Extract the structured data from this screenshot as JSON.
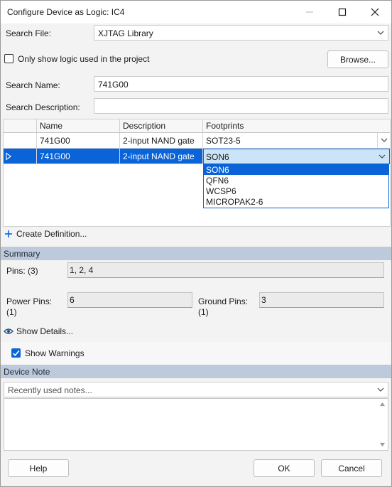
{
  "window": {
    "title": "Configure Device as Logic: IC4"
  },
  "search_file": {
    "label": "Search File:",
    "value": "XJTAG Library"
  },
  "only_show": {
    "label": "Only show logic used in the project",
    "checked": false
  },
  "browse_label": "Browse...",
  "search_name": {
    "label": "Search Name:",
    "value": "741G00"
  },
  "search_description": {
    "label": "Search Description:",
    "value": ""
  },
  "grid": {
    "columns": [
      "Name",
      "Description",
      "Footprints"
    ],
    "rows": [
      {
        "name": "741G00",
        "description": "2-input NAND gate",
        "footprint": "SOT23-5",
        "selected": false
      },
      {
        "name": "741G00",
        "description": "2-input NAND gate",
        "footprint": "SON6",
        "selected": true
      }
    ],
    "dropdown_options": [
      "SON6",
      "QFN6",
      "WCSP6",
      "MICROPAK2-6"
    ],
    "dropdown_selected": "SON6"
  },
  "create_definition_label": "Create Definition...",
  "summary": {
    "header": "Summary",
    "pins_label": "Pins: (3)",
    "pins_value": "1, 2, 4",
    "power_pins_label": "Power Pins:",
    "power_pins_count": "(1)",
    "power_pins_value": "6",
    "ground_pins_label": "Ground Pins:",
    "ground_pins_count": "(1)",
    "ground_pins_value": "3"
  },
  "show_details_label": "Show Details...",
  "show_warnings": {
    "label": "Show Warnings",
    "checked": true
  },
  "device_note": {
    "header": "Device Note",
    "placeholder": "Recently used notes...",
    "text": ""
  },
  "buttons": {
    "help": "Help",
    "ok": "OK",
    "cancel": "Cancel"
  },
  "colors": {
    "accent": "#0a64d8",
    "section_header": "#bccadb",
    "window_bg": "#f3f3f3"
  }
}
